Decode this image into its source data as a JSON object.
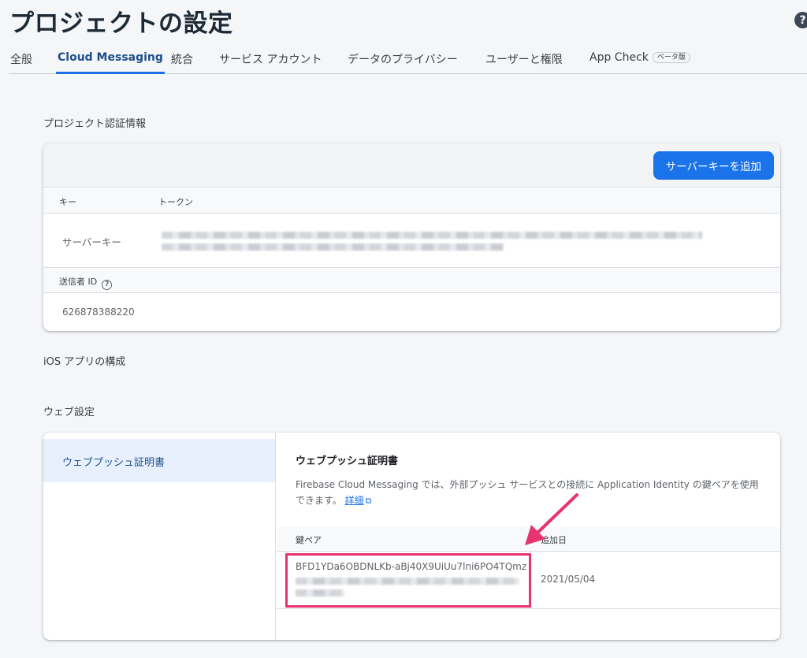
{
  "page": {
    "title": "プロジェクトの設定"
  },
  "tabs": [
    {
      "label": "全般"
    },
    {
      "label": "Cloud Messaging"
    },
    {
      "label": "統合"
    },
    {
      "label": "サービス アカウント"
    },
    {
      "label": "データのプライバシー"
    },
    {
      "label": "ユーザーと権限"
    },
    {
      "label": "App Check",
      "badge": "ベータ版"
    }
  ],
  "credentials": {
    "section_title": "プロジェクト認証情報",
    "add_button": "サーバーキーを追加",
    "columns": [
      "キー",
      "トークン"
    ],
    "server_key_label": "サーバーキー",
    "sender_id_label": "送信者 ID",
    "sender_id_value": "626878388220"
  },
  "ios": {
    "section_title": "iOS アプリの構成"
  },
  "web": {
    "section_title": "ウェブ設定",
    "nav_item": "ウェブプッシュ証明書",
    "panel_title": "ウェブプッシュ証明書",
    "description": "Firebase Cloud Messaging では、外部プッシュ サービスとの接続に Application Identity の鍵ペアを使用できます。",
    "details_link": "詳細",
    "columns": [
      "鍵ペア",
      "追加日"
    ],
    "key_pair_value": "BFD1YDa6OBDNLKb-aBj40X9UiUu7lni6PO4TQmz",
    "added_date": "2021/05/04"
  },
  "icons": {
    "help": "help-icon",
    "info": "info-icon",
    "external_link": "external-link-icon"
  },
  "colors": {
    "accent": "#1a73e8",
    "annotation": "#e8336f"
  }
}
